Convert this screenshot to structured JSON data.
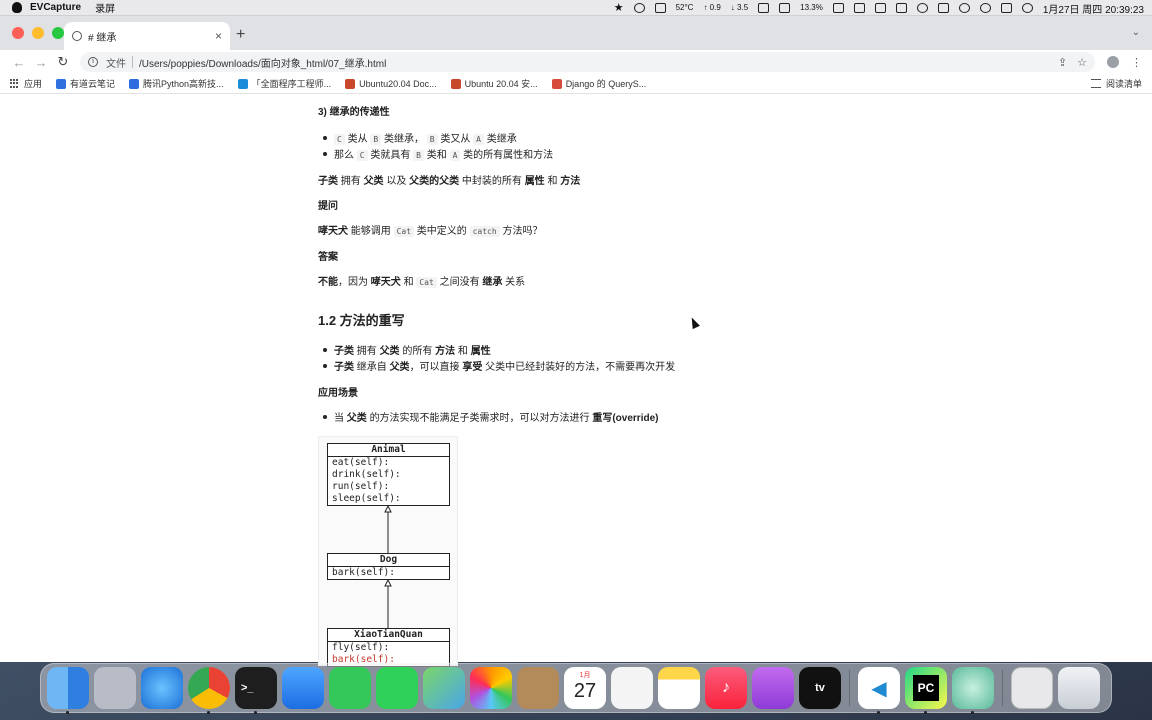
{
  "menubar": {
    "app_name": "EVCapture",
    "menu": "录屏",
    "weather_temp": "52°C",
    "net_up": "↑ 0.9",
    "net_down": "↓ 3.5",
    "cpu": "13.3%",
    "date_time": "1月27日 周四  20:39:23"
  },
  "browser": {
    "tab_title": "# 继承",
    "address_label": "文件",
    "url": "/Users/poppies/Downloads/面向对象_html/07_继承.html",
    "bookmarks": [
      {
        "label": "应用",
        "color": "#5f6368"
      },
      {
        "label": "有道云笔记",
        "color": "#2f6fde"
      },
      {
        "label": "腾讯Python高新技...",
        "color": "#2e6cdf"
      },
      {
        "label": "「全面程序工程师...",
        "color": "#1a8cd8"
      },
      {
        "label": "Ubuntu20.04 Doc...",
        "color": "#c9472b"
      },
      {
        "label": "Ubuntu 20.04 安...",
        "color": "#c9472b"
      },
      {
        "label": "Django 的 QueryS...",
        "color": "#d64b3a"
      }
    ],
    "reading_list": "阅读清单"
  },
  "doc": {
    "section3_heading": "3) 继承的传递性",
    "b1_c": "C",
    "b1_t1": "类从",
    "b1_b": "B",
    "b1_t2": "类继承，",
    "b1_b2": "B",
    "b1_t3": "类又从",
    "b1_a": "A",
    "b1_t4": "类继承",
    "b2_t1": "那么",
    "b2_c": "C",
    "b2_t2": "类就具有",
    "b2_b": "B",
    "b2_t3": "类和",
    "b2_a": "A",
    "b2_t4": "类的所有属性和方法",
    "p1_s1": "子类",
    "p1_t1": "拥有",
    "p1_s2": "父类",
    "p1_t2": "以及",
    "p1_s3": "父类的父类",
    "p1_t3": "中封装的所有",
    "p1_s4": "属性",
    "p1_t4": "和",
    "p1_s5": "方法",
    "q_heading": "提问",
    "q_s1": "哮天犬",
    "q_t1": "能够调用",
    "q_code1": "Cat",
    "q_t2": "类中定义的",
    "q_code2": "catch",
    "q_t3": "方法吗？",
    "a_heading": "答案",
    "a_s1": "不能",
    "a_t1": "，因为",
    "a_s2": "哮天犬",
    "a_t2": "和",
    "a_code": "Cat",
    "a_t3": "之间没有",
    "a_s3": "继承",
    "a_t4": "关系",
    "h2": "1.2 方法的重写",
    "c1_s1": "子类",
    "c1_t1": "拥有",
    "c1_s2": "父类",
    "c1_t2": "的所有",
    "c1_s3": "方法",
    "c1_t3": "和",
    "c1_s4": "属性",
    "c2_s1": "子类",
    "c2_t1": "继承自",
    "c2_s2": "父类",
    "c2_t2": "，可以直接",
    "c2_s3": "享受",
    "c2_t3": "父类中已经封装好的方法，不需要再次开发",
    "scene_heading": "应用场景",
    "s1_t1": "当",
    "s1_s1": "父类",
    "s1_t2": "的方法实现不能满足子类需求时，可以对方法进行",
    "s1_s2": "重写(override)"
  },
  "uml": {
    "animal": {
      "name": "Animal",
      "methods": [
        "eat(self):",
        "drink(self):",
        "run(self):",
        "sleep(self):"
      ]
    },
    "dog": {
      "name": "Dog",
      "methods": [
        "bark(self):"
      ]
    },
    "xtq": {
      "name": "XiaoTianQuan",
      "methods": [
        "fly(self):",
        "bark(self):"
      ]
    }
  },
  "dock": {
    "calendar_month": "1月",
    "calendar_day": "27",
    "appletv_label": "tv"
  }
}
